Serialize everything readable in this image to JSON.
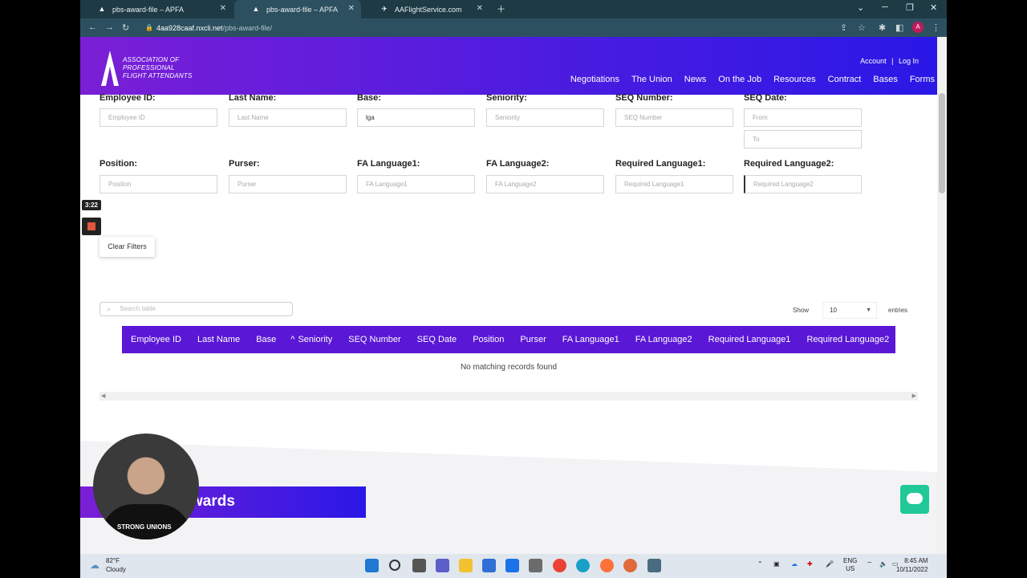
{
  "browser": {
    "tabs": [
      {
        "title": "pbs-award-file – APFA",
        "active": false
      },
      {
        "title": "pbs-award-file – APFA",
        "active": true
      },
      {
        "title": "AAFlightService.com",
        "active": false
      }
    ],
    "url_host": "4aa928caaf.nxcli.net",
    "url_path": "/pbs-award-file/",
    "profile_initial": "A"
  },
  "site": {
    "logo_line1": "ASSOCIATION OF",
    "logo_line2": "PROFESSIONAL",
    "logo_line3": "FLIGHT ATTENDANTS",
    "logo_mark": "APFA",
    "account": "Account",
    "separator": "|",
    "login": "Log In",
    "nav": [
      "Negotiations",
      "The Union",
      "News",
      "On the Job",
      "Resources",
      "Contract",
      "Bases",
      "Forms"
    ]
  },
  "filters": {
    "row1": [
      {
        "label": "Employee ID:",
        "placeholder": "Employee ID",
        "value": ""
      },
      {
        "label": "Last Name:",
        "placeholder": "Last Name",
        "value": ""
      },
      {
        "label": "Base:",
        "placeholder": "Base",
        "value": "lga"
      },
      {
        "label": "Seniority:",
        "placeholder": "Seniority",
        "value": ""
      },
      {
        "label": "SEQ Number:",
        "placeholder": "SEQ Number",
        "value": ""
      },
      {
        "label": "SEQ Date:",
        "placeholder": "From",
        "value": ""
      }
    ],
    "seq_date_to": "To",
    "row2": [
      {
        "label": "Position:",
        "placeholder": "Position"
      },
      {
        "label": "Purser:",
        "placeholder": "Purser"
      },
      {
        "label": "FA Language1:",
        "placeholder": "FA Language1"
      },
      {
        "label": "FA Language2:",
        "placeholder": "FA Language2"
      },
      {
        "label": "Required Language1:",
        "placeholder": "Required Language1"
      },
      {
        "label": "Required Language2:",
        "placeholder": "Required Language2"
      }
    ],
    "clear_label": "Clear Filters"
  },
  "recorder": {
    "time": "3:22"
  },
  "table": {
    "search_placeholder": "Search table",
    "show_label": "Show",
    "entries_value": "10",
    "entries_label": "entries",
    "columns": [
      "Employee ID",
      "Last Name",
      "Base",
      "Seniority",
      "SEQ Number",
      "SEQ Date",
      "Position",
      "Purser",
      "FA Language1",
      "FA Language2",
      "Required Language1",
      "Required Language2"
    ],
    "sorted_indicator": "^",
    "empty_message": "No matching records found"
  },
  "lower": {
    "banner_text": "wards",
    "webcam_shirt_text": "STRONG UNIONS"
  },
  "taskbar": {
    "temperature": "82°F",
    "condition": "Cloudy",
    "lang1": "ENG",
    "lang2": "US",
    "time": "8:45 AM",
    "date": "10/11/2022"
  },
  "colors": {
    "header_start": "#7a1fd6",
    "header_end": "#2a18e6",
    "table_header": "#5a17d6",
    "chat": "#20c997"
  }
}
